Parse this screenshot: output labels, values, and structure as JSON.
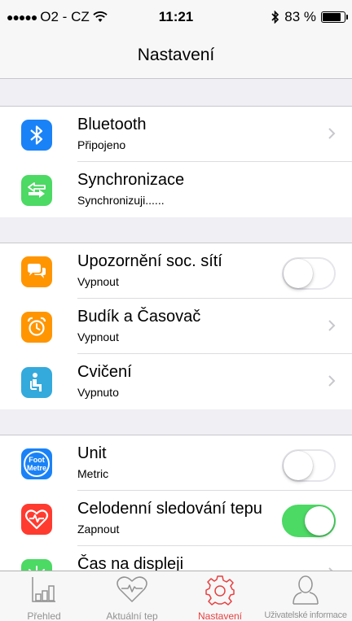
{
  "status": {
    "carrier": "O2 - CZ",
    "time": "11:21",
    "battery": "83 %",
    "battery_level": 0.83
  },
  "nav": {
    "title": "Nastavení"
  },
  "rows": [
    {
      "title": "Bluetooth",
      "subtitle": "Připojeno",
      "icon": "bluetooth-icon",
      "color": "#1a82f7",
      "accessory": "chevron"
    },
    {
      "title": "Synchronizace",
      "subtitle": "Synchronizuji......",
      "icon": "sync-icon",
      "color": "#4cd964",
      "accessory": "none"
    },
    {
      "title": "Upozornění soc. sítí",
      "subtitle": "Vypnout",
      "icon": "chat-bubbles-icon",
      "color": "#ff9500",
      "accessory": "toggle",
      "on": false
    },
    {
      "title": "Budík a Časovač",
      "subtitle": "Vypnout",
      "icon": "alarm-clock-icon",
      "color": "#ff9500",
      "accessory": "chevron"
    },
    {
      "title": "Cvičení",
      "subtitle": "Vypnuto",
      "icon": "person-seated-icon",
      "color": "#34aadc",
      "accessory": "chevron"
    },
    {
      "title": "Unit",
      "subtitle": "Metric",
      "icon": "foot-metre-icon",
      "color": "#1a82f7",
      "accessory": "toggle",
      "on": false,
      "icon_text_1": "Foot",
      "icon_text_2": "Metre"
    },
    {
      "title": "Celodenní sledování tepu",
      "subtitle": "Zapnout",
      "icon": "heart-rate-icon",
      "color": "#ff3b30",
      "accessory": "toggle",
      "on": true
    },
    {
      "title": "Čas na displeji",
      "subtitle": "",
      "icon": "sun-icon",
      "color": "#4cd964",
      "accessory": "chevron"
    }
  ],
  "tabs": [
    {
      "label": "Přehled",
      "icon": "bar-chart-icon",
      "active": false
    },
    {
      "label": "Aktuální tep",
      "icon": "heart-pulse-icon",
      "active": false
    },
    {
      "label": "Nastavení",
      "icon": "gear-icon",
      "active": true
    },
    {
      "label": "Uživatelské informace",
      "icon": "user-icon",
      "active": false
    }
  ],
  "colors": {
    "accent": "#e8403f",
    "toggle_on": "#4cd964",
    "chevron": "#c7c7cc"
  }
}
